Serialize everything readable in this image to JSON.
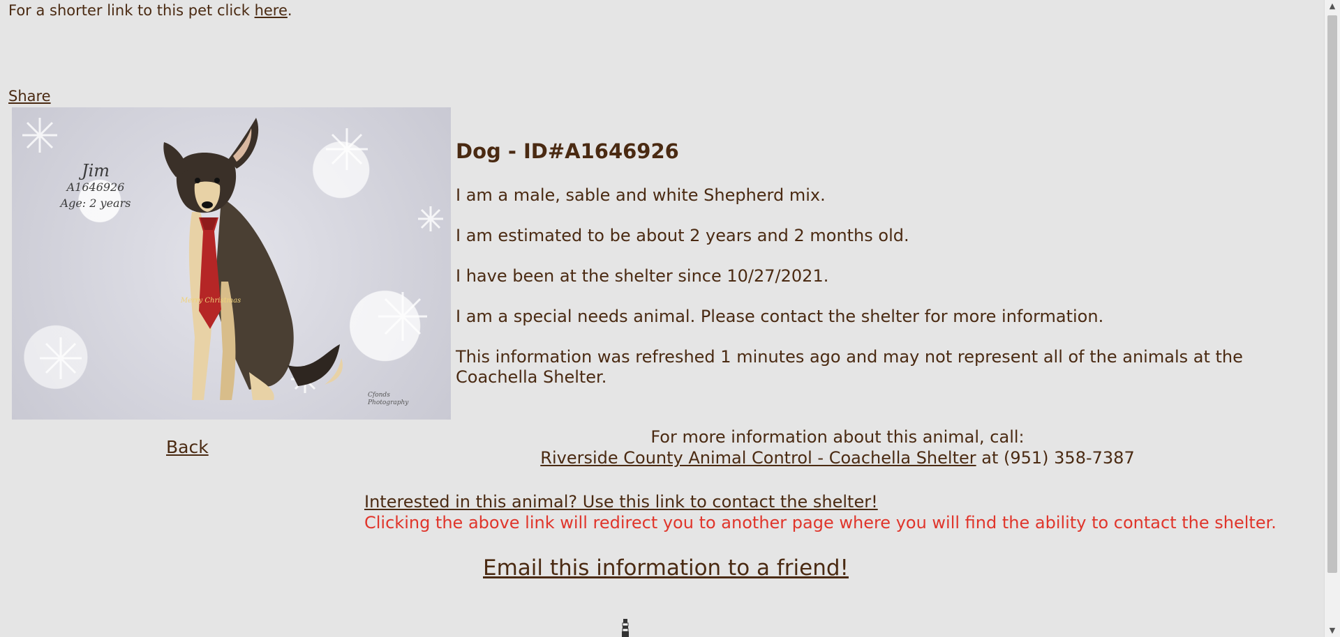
{
  "header": {
    "short_link_prefix": "For a shorter link to this pet click ",
    "short_link_label": "here",
    "short_link_suffix": ".",
    "share_label": "Share"
  },
  "photo": {
    "caption_name": "Jim",
    "caption_id": "A1646926",
    "caption_age": "Age: 2 years",
    "tie_text": "Merry Christmas",
    "credit_line1": "Cfonds",
    "credit_line2": "Photography"
  },
  "animal": {
    "title": "Dog - ID#A1646926",
    "description": "I am a male, sable and white Shepherd mix.",
    "age": "I am estimated to be about 2 years and 2 months old.",
    "since": "I have been at the shelter since 10/27/2021.",
    "special_needs": "I am a special needs animal. Please contact the shelter for more information.",
    "refreshed": "This information was refreshed 1 minutes ago and may not represent all of the animals at the Coachella Shelter."
  },
  "nav": {
    "back_label": "Back"
  },
  "contact": {
    "intro": "For more information about this animal, call:",
    "shelter_link": "Riverside County Animal Control - Coachella Shelter",
    "phone_text": " at (951) 358-7387"
  },
  "interest": {
    "link_label": "Interested in this animal? Use this link to contact the shelter!",
    "warning": "Clicking the above link will redirect you to another page where you will find the ability to contact the shelter."
  },
  "email": {
    "label": "Email this information to a friend!"
  },
  "colors": {
    "background": "#e5e5e5",
    "text": "#4a2a12",
    "warning": "#e0352b"
  }
}
